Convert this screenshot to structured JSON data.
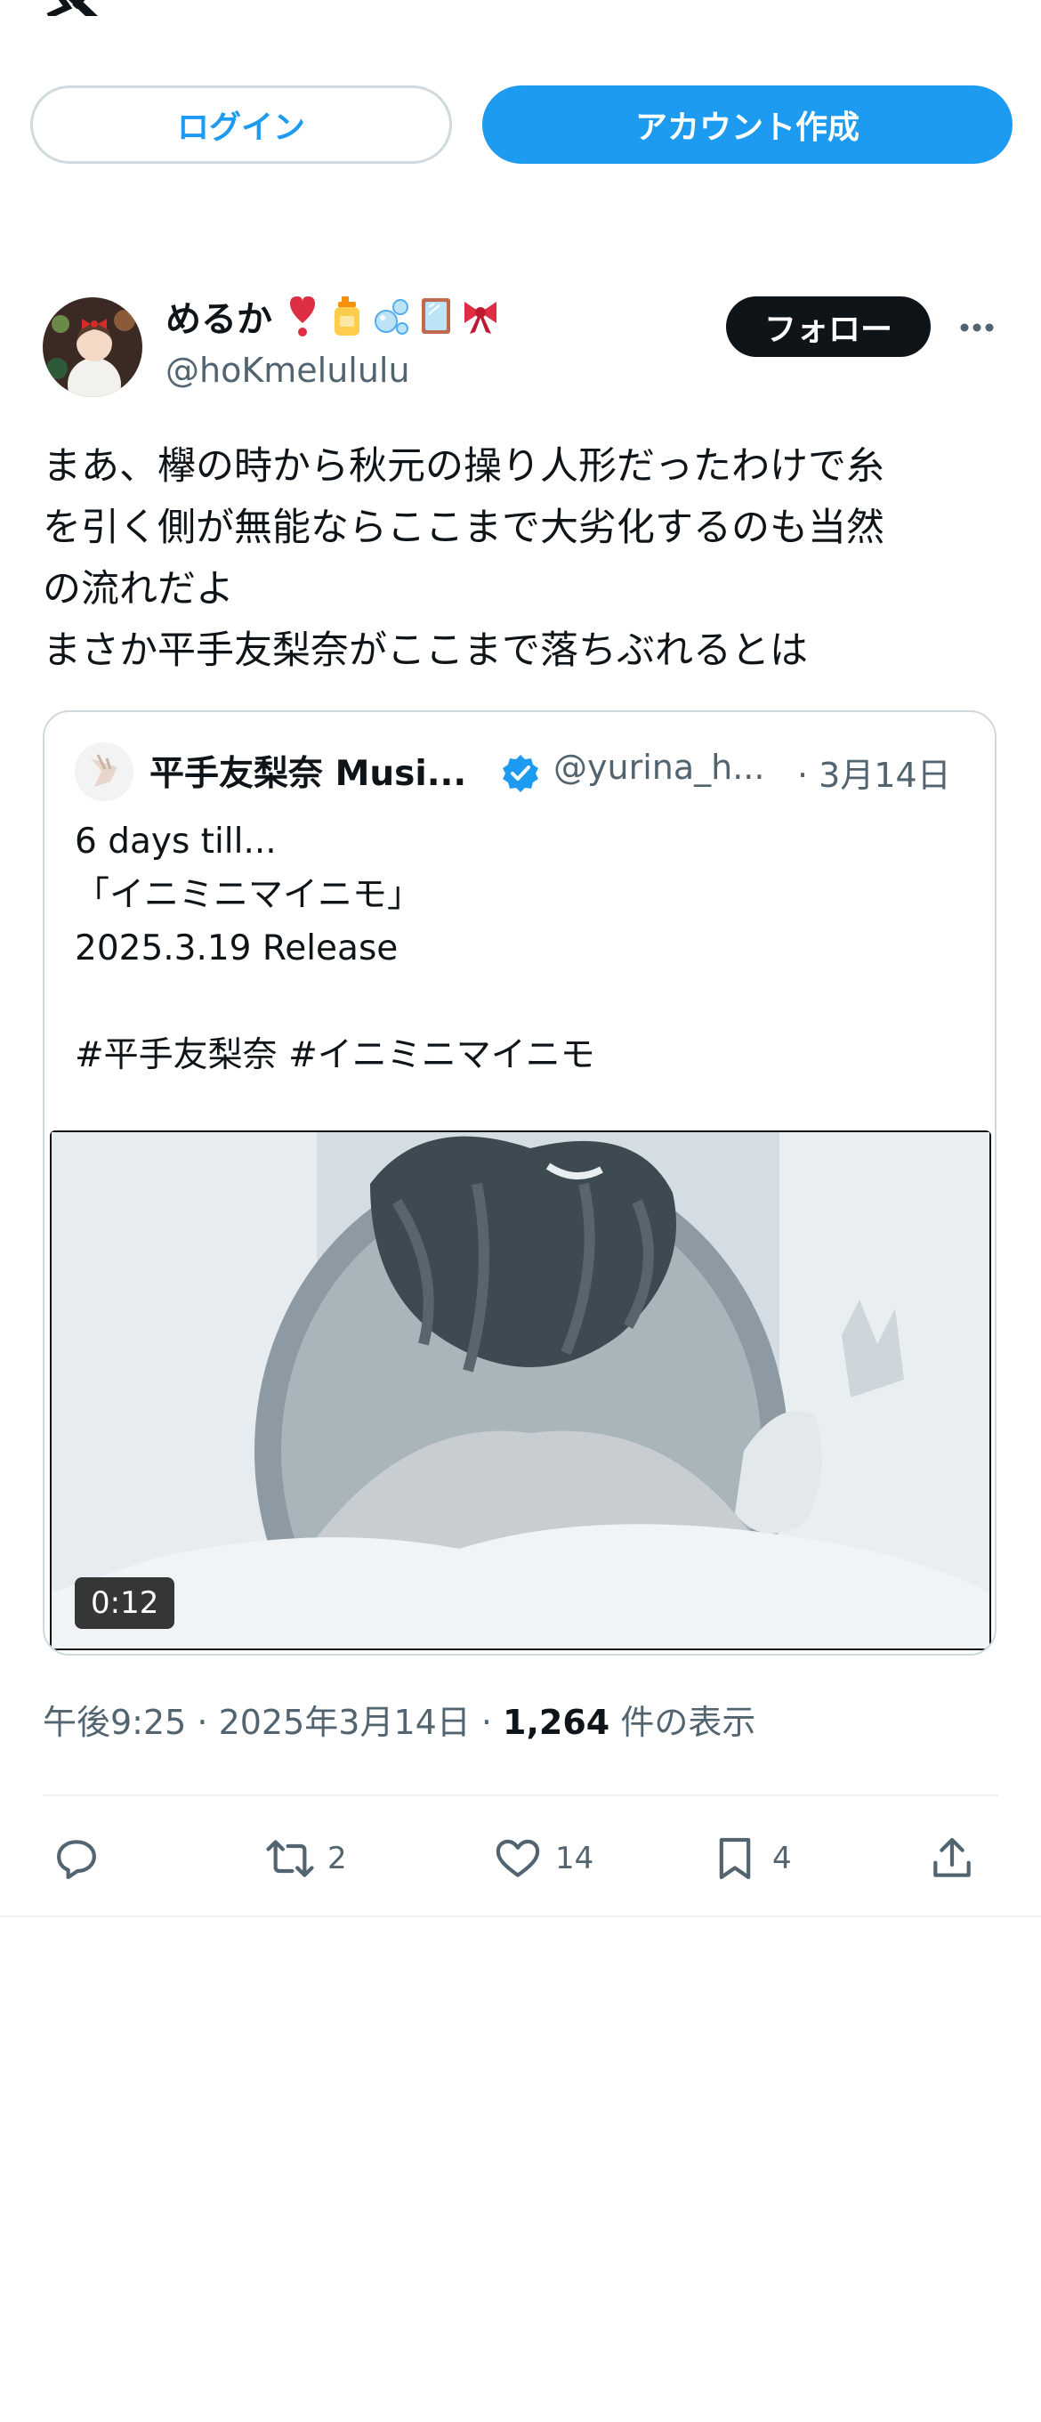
{
  "header": {
    "logo_icon": "x-logo-icon",
    "login_label": "ログイン",
    "signup_label": "アカウント作成"
  },
  "post": {
    "author": {
      "name": "めるか",
      "emoji_icons": [
        "heart-exclamation-icon",
        "lotion-bottle-icon",
        "bubbles-icon",
        "mirror-icon",
        "ribbon-icon"
      ],
      "handle": "@hoKmelululu",
      "follow_label": "フォロー"
    },
    "text": "まあ、欅の時から秋元の操り人形だったわけで糸\nを引く側が無能ならここまで大劣化するのも当然\nの流れだよ\nまさか平手友梨奈がここまで落ちぶれるとは",
    "quote": {
      "name": "平手友梨奈 Musi...",
      "verified": true,
      "handle": "@yurina_h...",
      "date": "· 3月14日",
      "text": "6 days till...\n「イニミニマイニモ」\n2025.3.19 Release\n\n#平手友梨奈 #イニミニマイニモ",
      "video": {
        "duration": "0:12"
      }
    },
    "meta": {
      "time_date": "午後9:25 · 2025年3月14日 · ",
      "views_count": "1,264",
      "views_label": " 件の表示"
    },
    "actions": {
      "reply_count": "",
      "retweet_count": "2",
      "like_count": "14",
      "bookmark_count": "4"
    }
  },
  "colors": {
    "accent": "#1d9bf0",
    "text_primary": "#0f1419",
    "text_secondary": "#536471",
    "border": "#cfd9de"
  }
}
